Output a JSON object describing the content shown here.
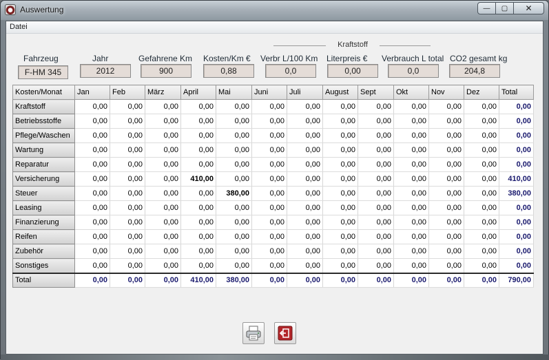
{
  "window": {
    "title": "Auswertung",
    "minimize": "—",
    "maximize": "▢",
    "close": "✕"
  },
  "menu": {
    "file": "Datei"
  },
  "kraftstoff_group": "Kraftstoff",
  "fields": [
    {
      "label": "Fahrzeug",
      "value": "F-HM 345"
    },
    {
      "label": "Jahr",
      "value": "2012"
    },
    {
      "label": "Gefahrene Km",
      "value": "900"
    },
    {
      "label": "Kosten/Km €",
      "value": "0,88"
    },
    {
      "label": "Verbr L/100 Km",
      "value": "0,0"
    },
    {
      "label": "Literpreis €",
      "value": "0,00"
    },
    {
      "label": "Verbrauch L total",
      "value": "0,0"
    },
    {
      "label": "CO2 gesamt kg",
      "value": "204,8"
    }
  ],
  "table": {
    "headers": [
      "Kosten/Monat",
      "Jan",
      "Feb",
      "März",
      "April",
      "Mai",
      "Juni",
      "Juli",
      "August",
      "Sept",
      "Okt",
      "Nov",
      "Dez",
      "Total"
    ],
    "rows": [
      {
        "label": "Kraftstoff",
        "values": [
          "0,00",
          "0,00",
          "0,00",
          "0,00",
          "0,00",
          "0,00",
          "0,00",
          "0,00",
          "0,00",
          "0,00",
          "0,00",
          "0,00"
        ],
        "total": "0,00"
      },
      {
        "label": "Betriebsstoffe",
        "values": [
          "0,00",
          "0,00",
          "0,00",
          "0,00",
          "0,00",
          "0,00",
          "0,00",
          "0,00",
          "0,00",
          "0,00",
          "0,00",
          "0,00"
        ],
        "total": "0,00"
      },
      {
        "label": "Pflege/Waschen",
        "values": [
          "0,00",
          "0,00",
          "0,00",
          "0,00",
          "0,00",
          "0,00",
          "0,00",
          "0,00",
          "0,00",
          "0,00",
          "0,00",
          "0,00"
        ],
        "total": "0,00"
      },
      {
        "label": "Wartung",
        "values": [
          "0,00",
          "0,00",
          "0,00",
          "0,00",
          "0,00",
          "0,00",
          "0,00",
          "0,00",
          "0,00",
          "0,00",
          "0,00",
          "0,00"
        ],
        "total": "0,00"
      },
      {
        "label": "Reparatur",
        "values": [
          "0,00",
          "0,00",
          "0,00",
          "0,00",
          "0,00",
          "0,00",
          "0,00",
          "0,00",
          "0,00",
          "0,00",
          "0,00",
          "0,00"
        ],
        "total": "0,00"
      },
      {
        "label": "Versicherung",
        "values": [
          "0,00",
          "0,00",
          "0,00",
          "410,00",
          "0,00",
          "0,00",
          "0,00",
          "0,00",
          "0,00",
          "0,00",
          "0,00",
          "0,00"
        ],
        "total": "410,00"
      },
      {
        "label": "Steuer",
        "values": [
          "0,00",
          "0,00",
          "0,00",
          "0,00",
          "380,00",
          "0,00",
          "0,00",
          "0,00",
          "0,00",
          "0,00",
          "0,00",
          "0,00"
        ],
        "total": "380,00"
      },
      {
        "label": "Leasing",
        "values": [
          "0,00",
          "0,00",
          "0,00",
          "0,00",
          "0,00",
          "0,00",
          "0,00",
          "0,00",
          "0,00",
          "0,00",
          "0,00",
          "0,00"
        ],
        "total": "0,00"
      },
      {
        "label": "Finanzierung",
        "values": [
          "0,00",
          "0,00",
          "0,00",
          "0,00",
          "0,00",
          "0,00",
          "0,00",
          "0,00",
          "0,00",
          "0,00",
          "0,00",
          "0,00"
        ],
        "total": "0,00"
      },
      {
        "label": "Reifen",
        "values": [
          "0,00",
          "0,00",
          "0,00",
          "0,00",
          "0,00",
          "0,00",
          "0,00",
          "0,00",
          "0,00",
          "0,00",
          "0,00",
          "0,00"
        ],
        "total": "0,00"
      },
      {
        "label": "Zubehör",
        "values": [
          "0,00",
          "0,00",
          "0,00",
          "0,00",
          "0,00",
          "0,00",
          "0,00",
          "0,00",
          "0,00",
          "0,00",
          "0,00",
          "0,00"
        ],
        "total": "0,00"
      },
      {
        "label": "Sonstiges",
        "values": [
          "0,00",
          "0,00",
          "0,00",
          "0,00",
          "0,00",
          "0,00",
          "0,00",
          "0,00",
          "0,00",
          "0,00",
          "0,00",
          "0,00"
        ],
        "total": "0,00"
      }
    ],
    "totals": {
      "label": "Total",
      "values": [
        "0,00",
        "0,00",
        "0,00",
        "410,00",
        "380,00",
        "0,00",
        "0,00",
        "0,00",
        "0,00",
        "0,00",
        "0,00",
        "0,00"
      ],
      "total": "790,00"
    }
  },
  "buttons": [
    {
      "name": "print-button",
      "icon": "printer-icon"
    },
    {
      "name": "exit-button",
      "icon": "exit-icon"
    }
  ],
  "colors": {
    "total_text": "#1a1a6e",
    "field_bg": "#e4dcd7",
    "exit_red": "#b3262a"
  }
}
